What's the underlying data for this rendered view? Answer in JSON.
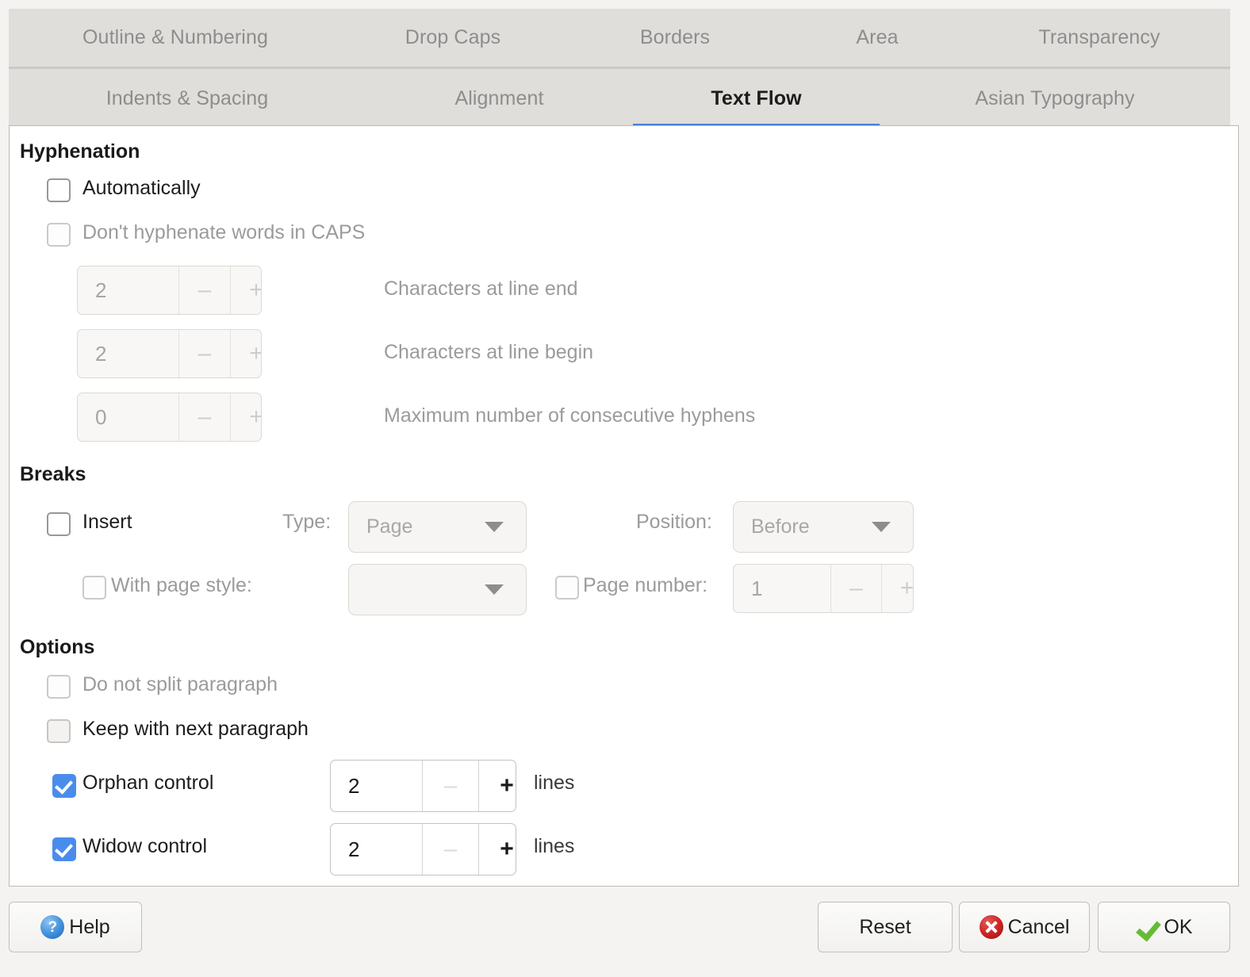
{
  "tabs": {
    "row1": [
      {
        "label": "Outline & Numbering",
        "selected": false
      },
      {
        "label": "Drop Caps",
        "selected": false
      },
      {
        "label": "Borders",
        "selected": false
      },
      {
        "label": "Area",
        "selected": false
      },
      {
        "label": "Transparency",
        "selected": false
      }
    ],
    "row2": [
      {
        "label": "Indents & Spacing",
        "selected": false
      },
      {
        "label": "Alignment",
        "selected": false
      },
      {
        "label": "Text Flow",
        "selected": true
      },
      {
        "label": "Asian Typography",
        "selected": false
      }
    ],
    "accent_color": "#4a80d4"
  },
  "hyphenation": {
    "title": "Hyphenation",
    "automatically": {
      "label": "Automatically",
      "checked": false,
      "enabled": true
    },
    "no_caps": {
      "label": "Don't hyphenate words in CAPS",
      "checked": false,
      "enabled": false
    },
    "chars_line_end": {
      "label": "Characters at line end",
      "value": "2",
      "minus": "–",
      "plus": "+",
      "enabled": false
    },
    "chars_line_begin": {
      "label": "Characters at line begin",
      "value": "2",
      "minus": "–",
      "plus": "+",
      "enabled": false
    },
    "max_hyphens": {
      "label": "Maximum number of consecutive hyphens",
      "value": "0",
      "minus": "–",
      "plus": "+",
      "enabled": false
    }
  },
  "breaks": {
    "title": "Breaks",
    "insert": {
      "label": "Insert",
      "checked": false,
      "enabled": true
    },
    "type": {
      "label": "Type:",
      "value": "Page",
      "enabled": false
    },
    "position": {
      "label": "Position:",
      "value": "Before",
      "enabled": false
    },
    "with_page_style": {
      "label": "With page style:",
      "checked": false,
      "enabled": false,
      "value": ""
    },
    "page_number": {
      "label": "Page number:",
      "checked": false,
      "enabled": false,
      "value": "1",
      "minus": "–",
      "plus": "+"
    }
  },
  "options": {
    "title": "Options",
    "do_not_split": {
      "label": "Do not split paragraph",
      "checked": false,
      "enabled": false
    },
    "keep_with_next": {
      "label": "Keep with next paragraph",
      "checked": false,
      "enabled": true
    },
    "orphan_control": {
      "label": "Orphan control",
      "checked": true,
      "enabled": true,
      "value": "2",
      "minus": "–",
      "plus": "+",
      "units": "lines"
    },
    "widow_control": {
      "label": "Widow control",
      "checked": true,
      "enabled": true,
      "value": "2",
      "minus": "–",
      "plus": "+",
      "units": "lines"
    }
  },
  "buttons": {
    "help": "Help",
    "reset": "Reset",
    "cancel": "Cancel",
    "ok": "OK",
    "help_icon_glyph": "?"
  }
}
